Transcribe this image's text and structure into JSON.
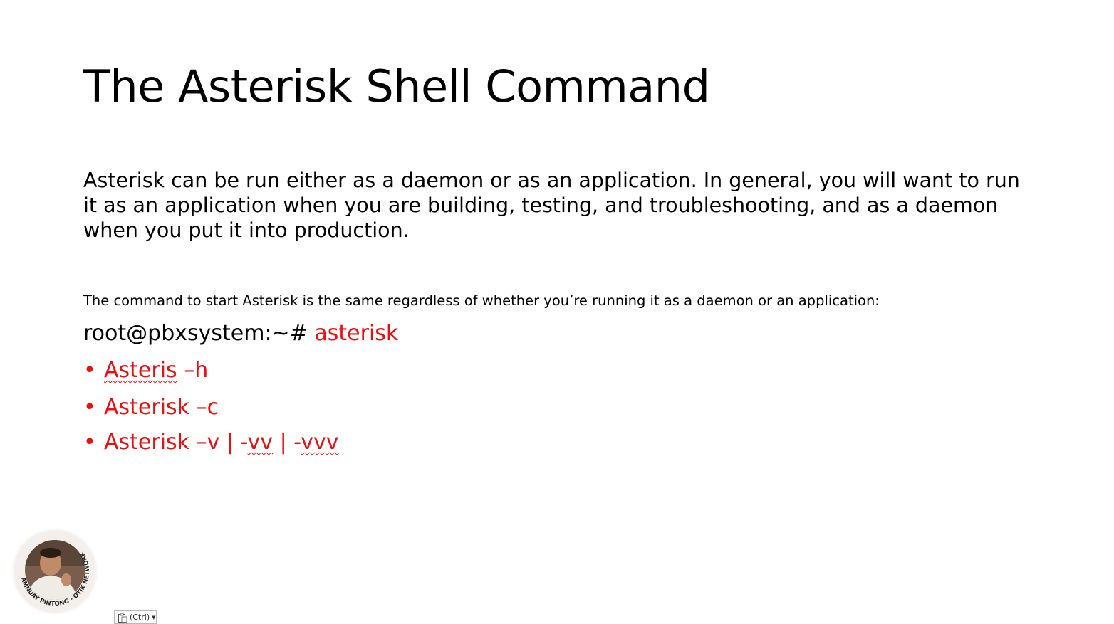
{
  "slide": {
    "title": "The Asterisk Shell Command",
    "paragraph": "Asterisk can be run either as a daemon or as an application. In general, you will want to run it as an application when you are building, testing, and troubleshooting, and as a daemon when you put it into production.",
    "note": "The command to start Asterisk is the same regardless of whether you’re running it as a daemon or an application:",
    "command": {
      "prompt": "root@pbxsystem:~# ",
      "text": "asterisk"
    },
    "bullets": [
      {
        "marker": "•",
        "parts": [
          "Asteris",
          " –h"
        ]
      },
      {
        "marker": "•",
        "parts": [
          "Asterisk –c"
        ]
      },
      {
        "marker": "•",
        "parts": [
          "Asterisk –v | -",
          "vv",
          " | -",
          "vvv"
        ]
      }
    ],
    "accent_color": "#e81010"
  },
  "presenter": {
    "ring_text": "AMNUAY PINTONG - OTIK NETWORK"
  },
  "paste_options": {
    "label": "(Ctrl)",
    "icon": "clipboard-icon"
  }
}
